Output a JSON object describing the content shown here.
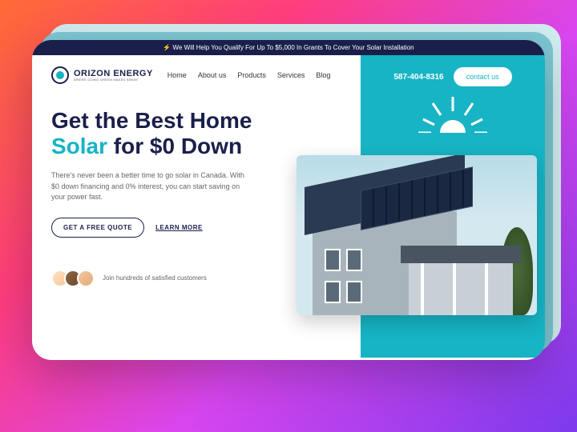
{
  "banner": {
    "text": "⚡ We Will Help You Qualify For Up To $5,000 In Grants To Cover Your Solar Installation"
  },
  "logo": {
    "name": "ORIZON ENERGY",
    "tagline": "WHERE GOING GREEN MAKES SENSE"
  },
  "nav": {
    "items": [
      "Home",
      "About us",
      "Products",
      "Services",
      "Blog"
    ]
  },
  "hero": {
    "title_line1": "Get the Best Home",
    "title_accent": "Solar",
    "title_line2_rest": " for $0 Down",
    "description": "There's never been a better time to go solar in Canada. With $0 down financing and 0% interest, you can start saving on your power fast.",
    "cta_primary": "GET A FREE QUOTE",
    "cta_secondary": "LEARN MORE"
  },
  "social_proof": {
    "text": "Join hundreds of satisfied customers"
  },
  "contact": {
    "phone": "587-404-8316",
    "button": "contact us"
  }
}
